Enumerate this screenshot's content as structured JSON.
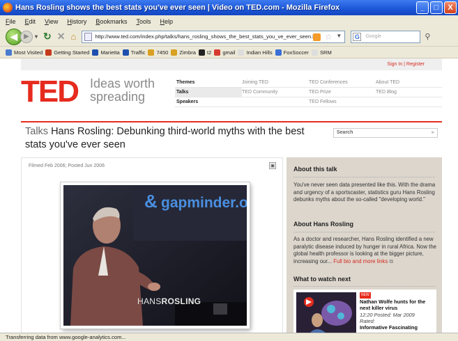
{
  "window": {
    "title": "Hans Rosling shows the best stats you've ever seen | Video on TED.com - Mozilla Firefox",
    "controls": [
      "_",
      "□",
      "X"
    ]
  },
  "menu": [
    "File",
    "Edit",
    "View",
    "History",
    "Bookmarks",
    "Tools",
    "Help"
  ],
  "nav": {
    "url": "http://www.ted.com/index.php/talks/hans_rosling_shows_the_best_stats_you_ve_ever_seen.html",
    "search_placeholder": "Google",
    "search_engine_letter": "G"
  },
  "bookmarks": [
    {
      "label": "Most Visited",
      "color": "#4a7bd0"
    },
    {
      "label": "Getting Started",
      "color": "#c43a1a"
    },
    {
      "label": "Marietta",
      "color": "#1f4fae"
    },
    {
      "label": "Traffic",
      "color": "#1f4fae"
    },
    {
      "label": "7450",
      "color": "#d9a021"
    },
    {
      "label": "Zimbra",
      "color": "#d9a021"
    },
    {
      "label": "t2",
      "color": "#222222"
    },
    {
      "label": "gmail",
      "color": "#d63b2f"
    },
    {
      "label": "Indian Hills",
      "color": "#dddddd"
    },
    {
      "label": "FoxSoccer",
      "color": "#3a6fd6"
    },
    {
      "label": "SRM",
      "color": "#dddddd"
    }
  ],
  "page": {
    "signin": "Sign In | Register",
    "logo": "TED",
    "tagline_line1": "Ideas worth",
    "tagline_line2": "spreading",
    "main_nav": [
      [
        "Themes",
        "Joining TED",
        "TED Conferences",
        "About TED"
      ],
      [
        "Talks",
        "TED Community",
        "TED Prize",
        "TED Blog"
      ],
      [
        "Speakers",
        "",
        "TED Fellows",
        ""
      ]
    ],
    "section": "Talks",
    "title": "Hans Rosling: Debunking third-world myths with the best stats you've ever seen",
    "site_search": "Search",
    "filmed": "Filmed Feb 2006; Posted Jun 2006",
    "video": {
      "overlay_brand": "gapminder.org",
      "ampersand": "&",
      "lower_third_first": "HANS",
      "lower_third_last": "ROSLING"
    },
    "about_talk_heading": "About this talk",
    "about_talk_text": "You've never seen data presented like this. With the drama and urgency of a sportscaster, statistics guru Hans Rosling debunks myths about the so-called \"developing world.\"",
    "about_speaker_heading": "About Hans Rosling",
    "about_speaker_text": "As a doctor and researcher, Hans Rosling identified a new paralytic disease induced by hunger in rural Africa. Now the global health professor is looking at the bigger picture, increasing our...",
    "full_bio_link": "Full bio and more links",
    "watch_heading": "What to watch next",
    "watch": {
      "badge": "NEW",
      "title": "Nathan Wolfe hunts for the next killer virus",
      "meta": "12:20 Posted: Mar 2009",
      "rated_label": "Rated:",
      "rated_value": "Informative Fascinating"
    }
  },
  "status": "Transferring data from www.google-analytics.com..."
}
